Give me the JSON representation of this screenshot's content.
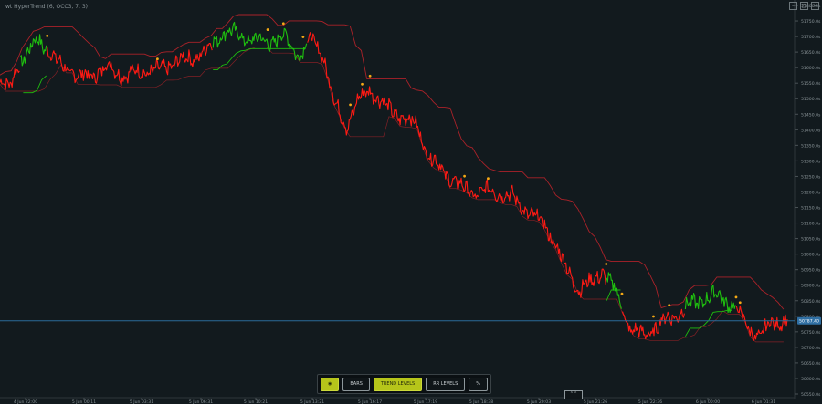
{
  "indicator": {
    "label": "wt HyperTrend (6, OCC3, 7, 3)"
  },
  "window_controls": {
    "minimize": "–",
    "maximize": "□",
    "close": "×"
  },
  "toolbar": {
    "eye_icon": "◉",
    "bars": "BARS",
    "trend_levels": "TREND LEVELS",
    "rr_levels": "RR LEVELS",
    "percent": "%"
  },
  "expander_icon": "⌃⌃",
  "colors": {
    "up": "#1fbf0f",
    "down": "#ff1a14",
    "flip": "#f4a915",
    "band": "#b3232a",
    "price_line": "#2b6b98",
    "price_tag_bg": "#2f6fa3"
  },
  "price_tag": "50787.40",
  "chart_data": {
    "type": "line",
    "y_ticks": [
      "51800.0s",
      "51750.0s",
      "51700.0s",
      "51650.0s",
      "51600.0s",
      "51550.0s",
      "51500.0s",
      "51450.0s",
      "51400.0s",
      "51350.0s",
      "51300.0s",
      "51250.0s",
      "51200.0s",
      "51150.0s",
      "51100.0s",
      "51050.0s",
      "51000.0s",
      "50950.0s",
      "50900.0s",
      "50850.0s",
      "50800.0s",
      "50750.0s",
      "50700.0s",
      "50650.0s",
      "50600.0s",
      "50550.0s"
    ],
    "x_ticks": [
      "4 Jun 22:00",
      "5 Jun 00:11",
      "5 Jun 03:31",
      "5 Jun 06:31",
      "5 Jun 10:21",
      "5 Jun 13:21",
      "5 Jun 16:17",
      "5 Jun 17:19",
      "5 Jun 18:38",
      "5 Jun 20:03",
      "5 Jun 21:26",
      "5 Jun 22:36",
      "6 Jun 00:00",
      "6 Jun 01:31",
      "6 Jun 04:00"
    ],
    "ylim": [
      50550,
      51810
    ],
    "current_price": 50787.4,
    "price_path": [
      {
        "t": 0.0,
        "p": 51560
      },
      {
        "t": 0.012,
        "p": 51540
      },
      {
        "t": 0.022,
        "p": 51620
      },
      {
        "t": 0.035,
        "p": 51650
      },
      {
        "t": 0.048,
        "p": 51705
      },
      {
        "t": 0.06,
        "p": 51670
      },
      {
        "t": 0.072,
        "p": 51625
      },
      {
        "t": 0.085,
        "p": 51610
      },
      {
        "t": 0.1,
        "p": 51575
      },
      {
        "t": 0.12,
        "p": 51590
      },
      {
        "t": 0.14,
        "p": 51610
      },
      {
        "t": 0.16,
        "p": 51580
      },
      {
        "t": 0.18,
        "p": 51600
      },
      {
        "t": 0.2,
        "p": 51595
      },
      {
        "t": 0.22,
        "p": 51625
      },
      {
        "t": 0.245,
        "p": 51640
      },
      {
        "t": 0.265,
        "p": 51670
      },
      {
        "t": 0.285,
        "p": 51730
      },
      {
        "t": 0.3,
        "p": 51715
      },
      {
        "t": 0.32,
        "p": 51700
      },
      {
        "t": 0.34,
        "p": 51690
      },
      {
        "t": 0.36,
        "p": 51710
      },
      {
        "t": 0.38,
        "p": 51650
      },
      {
        "t": 0.395,
        "p": 51700
      },
      {
        "t": 0.41,
        "p": 51655
      },
      {
        "t": 0.425,
        "p": 51490
      },
      {
        "t": 0.44,
        "p": 51420
      },
      {
        "t": 0.455,
        "p": 51500
      },
      {
        "t": 0.47,
        "p": 51540
      },
      {
        "t": 0.49,
        "p": 51480
      },
      {
        "t": 0.51,
        "p": 51450
      },
      {
        "t": 0.53,
        "p": 51420
      },
      {
        "t": 0.545,
        "p": 51320
      },
      {
        "t": 0.565,
        "p": 51270
      },
      {
        "t": 0.585,
        "p": 51220
      },
      {
        "t": 0.605,
        "p": 51200
      },
      {
        "t": 0.625,
        "p": 51210
      },
      {
        "t": 0.65,
        "p": 51190
      },
      {
        "t": 0.675,
        "p": 51130
      },
      {
        "t": 0.695,
        "p": 51090
      },
      {
        "t": 0.715,
        "p": 50980
      },
      {
        "t": 0.735,
        "p": 50890
      },
      {
        "t": 0.75,
        "p": 50910
      },
      {
        "t": 0.765,
        "p": 50950
      },
      {
        "t": 0.785,
        "p": 50870
      },
      {
        "t": 0.8,
        "p": 50760
      },
      {
        "t": 0.815,
        "p": 50740
      },
      {
        "t": 0.83,
        "p": 50760
      },
      {
        "t": 0.845,
        "p": 50790
      },
      {
        "t": 0.86,
        "p": 50810
      },
      {
        "t": 0.878,
        "p": 50840
      },
      {
        "t": 0.895,
        "p": 50860
      },
      {
        "t": 0.912,
        "p": 50870
      },
      {
        "t": 0.93,
        "p": 50840
      },
      {
        "t": 0.95,
        "p": 50770
      },
      {
        "t": 0.965,
        "p": 50730
      },
      {
        "t": 0.98,
        "p": 50785
      },
      {
        "t": 1.0,
        "p": 50787
      }
    ],
    "trend_segments": [
      {
        "from": 0.0,
        "to": 0.025,
        "direction": "down"
      },
      {
        "from": 0.025,
        "to": 0.06,
        "direction": "up"
      },
      {
        "from": 0.06,
        "to": 0.27,
        "direction": "down"
      },
      {
        "from": 0.27,
        "to": 0.39,
        "direction": "up"
      },
      {
        "from": 0.39,
        "to": 0.77,
        "direction": "down"
      },
      {
        "from": 0.77,
        "to": 0.79,
        "direction": "up"
      },
      {
        "from": 0.79,
        "to": 0.87,
        "direction": "down"
      },
      {
        "from": 0.87,
        "to": 0.935,
        "direction": "up"
      },
      {
        "from": 0.935,
        "to": 1.0,
        "direction": "down"
      }
    ],
    "flip_markers": [
      0.06,
      0.2,
      0.34,
      0.36,
      0.385,
      0.445,
      0.46,
      0.47,
      0.59,
      0.62,
      0.77,
      0.79,
      0.83,
      0.85,
      0.935,
      0.94
    ]
  }
}
